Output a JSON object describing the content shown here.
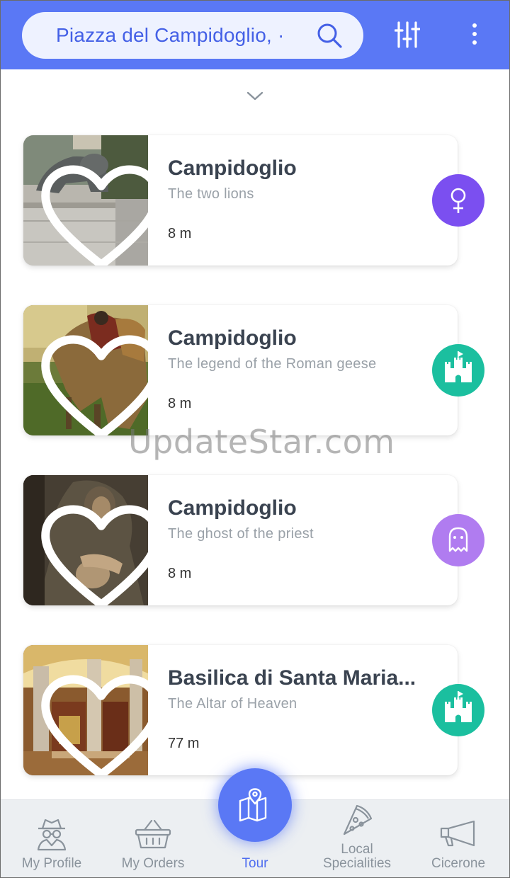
{
  "header": {
    "search_value": "Piazza del Campidoglio, ·",
    "search_icon": "search-icon",
    "filter_icon": "sliders-icon",
    "menu_icon": "more-vertical-icon"
  },
  "colors": {
    "primary": "#5a78f5",
    "violet_badge": "#7b4ff0",
    "teal_badge": "#1bbf9f",
    "lilac_badge": "#b07cf0",
    "muted_text": "#9aa1a8"
  },
  "cards": [
    {
      "title": "Campidoglio",
      "subtitle": "The two lions",
      "distance": "8 m",
      "badge_icon": "venus-symbol-icon"
    },
    {
      "title": "Campidoglio",
      "subtitle": "The legend of the Roman geese",
      "distance": "8 m",
      "badge_icon": "castle-icon"
    },
    {
      "title": "Campidoglio",
      "subtitle": "The ghost of the priest",
      "distance": "8 m",
      "badge_icon": "ghost-icon"
    },
    {
      "title": "Basilica di Santa Maria...",
      "subtitle": "The Altar of Heaven",
      "distance": "77 m",
      "badge_icon": "castle-icon"
    }
  ],
  "watermark": "UpdateStar.com",
  "nav": {
    "profile": "My Profile",
    "orders": "My Orders",
    "tour": "Tour",
    "local_line1": "Local",
    "local_line2": "Specialities",
    "cicerone": "Cicerone"
  }
}
